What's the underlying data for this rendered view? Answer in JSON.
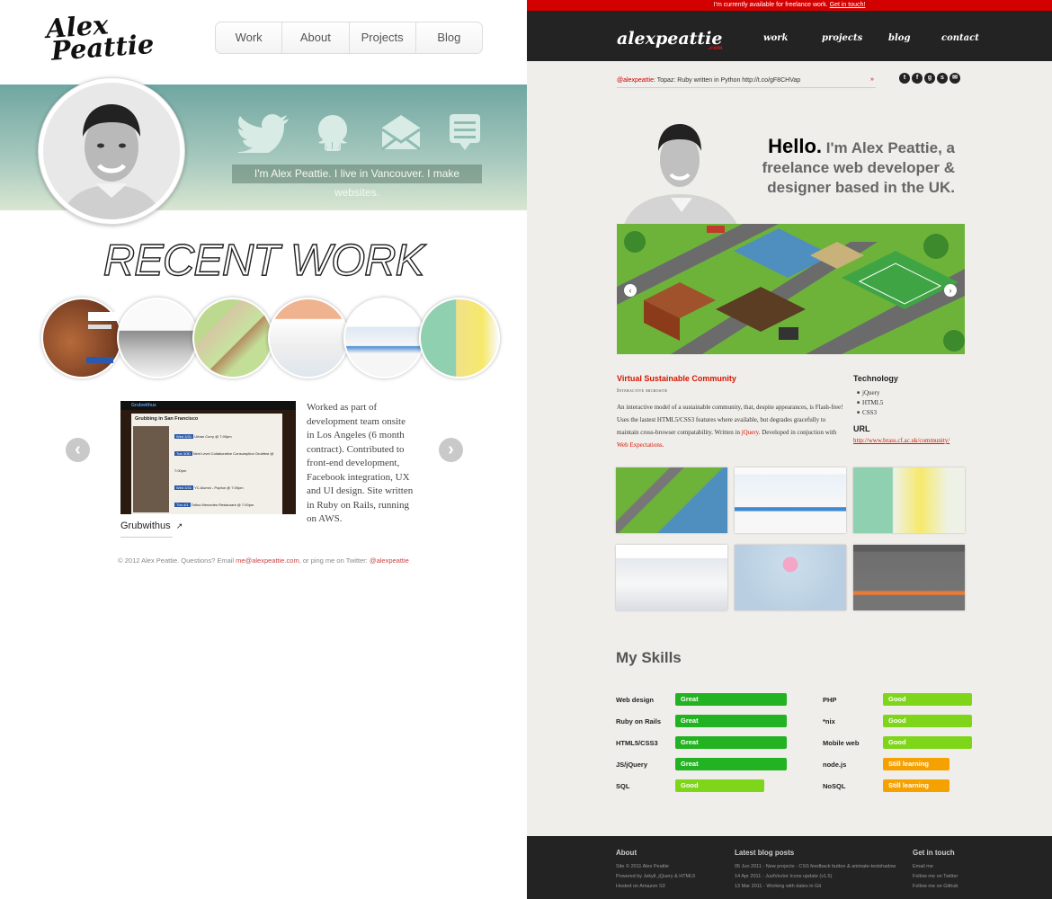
{
  "left_site": {
    "logo": {
      "line1": "Alex",
      "line2": "Peattie"
    },
    "nav": [
      "Work",
      "About",
      "Projects",
      "Blog"
    ],
    "tagline": "I'm Alex Peattie. I live in Vancouver. I make websites.",
    "header_icons": [
      "twitter-bird-icon",
      "github-octocat-icon",
      "mail-envelope-icon",
      "chat-bubble-icon"
    ],
    "heading": "RECENT WORK",
    "project_thumbs": [
      "project-hello-thumb",
      "project-bingo-thumb",
      "project-virtual-farm-thumb",
      "project-lobby-thumb",
      "project-prepcode-thumb",
      "project-welcome-thumb"
    ],
    "prev_arrow": "‹",
    "next_arrow": "›",
    "featured": {
      "name": "Grubwithus",
      "description": "Worked as part of development team onsite in Los Angeles (6 month contract). Contributed to front-end development, Facebook integration, UX and UI design. Site written in Ruby on Rails, running on AWS.",
      "screenshot": {
        "brand": "Grubwithus",
        "panel_title": "Grubbing in San Francisco",
        "events": [
          "Urban Curry @ 7:00pm",
          "Next Level Collaborative Consumption Grubfest @ 7:00pm",
          "YC Alumni - Popfun @ 7:00pm",
          "Tofino Mercedes Restaurant @ 7:00pm"
        ],
        "dates": [
          "Wed 3/31",
          "Tue 3/30",
          "Wed 3/31",
          "Thu 4/1"
        ]
      }
    },
    "footer": {
      "text": "© 2012 Alex Peattie. Questions? Email ",
      "email": "me@alexpeattie.com",
      "mid": ", or ping me on Twitter: ",
      "twitter": "@alexpeattie"
    }
  },
  "right_site": {
    "availability": {
      "text": "I'm currently available for freelance work. ",
      "link": "Get in touch!"
    },
    "logo": "alexpeattie",
    "logo_suffix": ".com",
    "nav": [
      "work",
      "projects",
      "blog",
      "contact"
    ],
    "tweet": {
      "handle": "@alexpeattie",
      "text": ": Topaz: Ruby written in Python http://t.co/gF8CHVap",
      "arrow": "»"
    },
    "social_icons": [
      "twitter-icon",
      "facebook-icon",
      "google-icon",
      "skype-icon",
      "email-icon"
    ],
    "hello": {
      "bold": "Hello.",
      "rest": "I'm Alex Peattie, a freelance web developer & designer based in the UK."
    },
    "slider": {
      "prev": "‹",
      "next": "›"
    },
    "project": {
      "title": "Virtual Sustainable Community",
      "subtitle": "Interactive microsite",
      "description_before": "An interactive model of a sustainable community, that, despite appearances, is Flash-free! Uses the lastest HTML5/CSS3 features where available, but degrades gracefully to maintain cross-browser compatability. Written in ",
      "jquery": "jQuery",
      "description_mid": ". Developed in conjuction with ",
      "web_expectations": "Web Expectations",
      "description_end": ".",
      "technology_heading": "Technology",
      "technologies": [
        "jQuery",
        "HTML5",
        "CSS3"
      ],
      "url_heading": "URL",
      "url": "http://www.brass.cf.ac.uk/community/"
    },
    "portfolio_thumbs": [
      "portfolio-farm-thumb",
      "portfolio-prepcode-thumb",
      "portfolio-welcome-thumb",
      "portfolio-brass-thumb",
      "portfolio-greenues-thumb",
      "portfolio-energy-thumb"
    ],
    "skills_heading": "My Skills",
    "skills_left": [
      {
        "name": "Web design",
        "level": "Great",
        "color": "#22b222",
        "value": 100
      },
      {
        "name": "Ruby on Rails",
        "level": "Great",
        "color": "#22b222",
        "value": 100
      },
      {
        "name": "HTML5/CSS3",
        "level": "Great",
        "color": "#22b222",
        "value": 100
      },
      {
        "name": "JS/jQuery",
        "level": "Great",
        "color": "#22b222",
        "value": 100
      },
      {
        "name": "SQL",
        "level": "Good",
        "color": "#7fd51a",
        "value": 80
      }
    ],
    "skills_right": [
      {
        "name": "PHP",
        "level": "Good",
        "color": "#7fd51a",
        "value": 80
      },
      {
        "name": "*nix",
        "level": "Good",
        "color": "#7fd51a",
        "value": 80
      },
      {
        "name": "Mobile web",
        "level": "Good",
        "color": "#7fd51a",
        "value": 80
      },
      {
        "name": "node.js",
        "level": "Still learning",
        "color": "#f5a100",
        "value": 60
      },
      {
        "name": "NoSQL",
        "level": "Still learning",
        "color": "#f5a100",
        "value": 60
      }
    ],
    "footer": {
      "about_heading": "About",
      "about_lines": [
        "Site © 2011 Alex Peattie",
        "Powered by Jekyll, jQuery & HTML5",
        "Hosted on Amazon S3"
      ],
      "blog_heading": "Latest blog posts",
      "blog_lines": [
        "05 Jun 2011 - New projects - CSS feedback button & animate-textshadow",
        "14 Apr 2011 - JustVector Icons update (v1.5)",
        "13 Mar 2011 - Working with dates in Git"
      ],
      "contact_heading": "Get in touch",
      "contact_lines": [
        "Email me",
        "Follow me on Twitter",
        "Follow me on Github"
      ]
    }
  }
}
